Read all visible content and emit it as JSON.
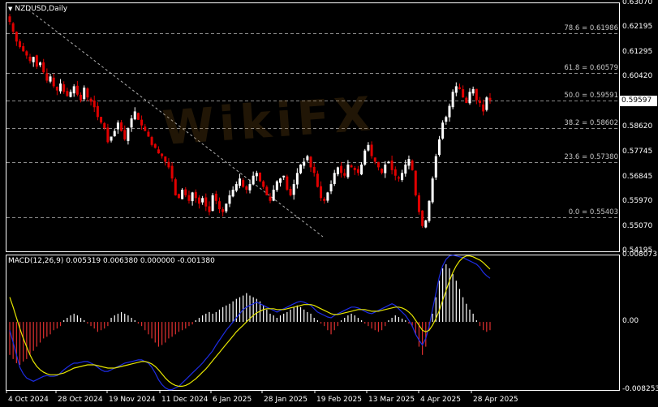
{
  "window": {
    "symbol_title": "NZDUSD,Daily",
    "macd_title": "MACD(12,26,9) 0.005319 0.006380 0.000000 -0.001380",
    "watermark": "WikiFX"
  },
  "colors": {
    "background": "#000000",
    "grid_border": "#ffffff",
    "bull_candle": "#ffffff",
    "bear_candle": "#e00000",
    "fib_line": "#8c8c8c",
    "trendline": "#b0b0b0",
    "macd_line": "#1e2de6",
    "signal_line": "#e6e600",
    "hist_pos": "#ffffff",
    "hist_neg": "#e03030"
  },
  "price_axis": {
    "labels": [
      "0.63070",
      "0.62195",
      "0.61295",
      "0.60420",
      "0.59520",
      "0.58620",
      "0.57745",
      "0.56845",
      "0.55970",
      "0.55070",
      "0.54195"
    ],
    "current_price": "0.59597"
  },
  "macd_axis": {
    "labels": [
      "0.008073",
      "0.00",
      "-0.008253"
    ]
  },
  "date_axis": {
    "labels": [
      "4 Oct 2024",
      "28 Oct 2024",
      "19 Nov 2024",
      "11 Dec 2024",
      "6 Jan 2025",
      "28 Jan 2025",
      "19 Feb 2025",
      "13 Mar 2025",
      "4 Apr 2025",
      "28 Apr 2025"
    ]
  },
  "fibonacci": [
    {
      "label": "78.6 = 0.61986",
      "price": 0.61986
    },
    {
      "label": "61.8 = 0.60579",
      "price": 0.60579
    },
    {
      "label": "50.0 = 0.59591",
      "price": 0.59591
    },
    {
      "label": "38.2 = 0.58602",
      "price": 0.58602
    },
    {
      "label": "23.6 = 0.57380",
      "price": 0.5738
    },
    {
      "label": "0.0 = 0.55403",
      "price": 0.55403
    }
  ],
  "chart_data": {
    "type": "candlestick",
    "title": "NZDUSD,Daily",
    "ylim": [
      0.54195,
      0.6307
    ],
    "x_start": "2024-09-30",
    "close_path": [
      0.624,
      0.6205,
      0.617,
      0.615,
      0.6135,
      0.612,
      0.61,
      0.6115,
      0.608,
      0.6095,
      0.606,
      0.603,
      0.6045,
      0.601,
      0.5995,
      0.602,
      0.599,
      0.5975,
      0.599,
      0.601,
      0.598,
      0.596,
      0.6005,
      0.597,
      0.5955,
      0.5935,
      0.59,
      0.588,
      0.586,
      0.581,
      0.583,
      0.585,
      0.588,
      0.585,
      0.582,
      0.586,
      0.5895,
      0.592,
      0.589,
      0.587,
      0.585,
      0.583,
      0.58,
      0.579,
      0.577,
      0.576,
      0.574,
      0.572,
      0.568,
      0.562,
      0.561,
      0.564,
      0.562,
      0.56,
      0.563,
      0.561,
      0.559,
      0.561,
      0.558,
      0.556,
      0.562,
      0.56,
      0.557,
      0.556,
      0.559,
      0.562,
      0.564,
      0.566,
      0.568,
      0.565,
      0.564,
      0.566,
      0.569,
      0.57,
      0.567,
      0.565,
      0.562,
      0.56,
      0.564,
      0.567,
      0.568,
      0.569,
      0.564,
      0.562,
      0.566,
      0.57,
      0.573,
      0.574,
      0.576,
      0.572,
      0.57,
      0.565,
      0.561,
      0.56,
      0.563,
      0.566,
      0.57,
      0.572,
      0.57,
      0.569,
      0.573,
      0.572,
      0.571,
      0.57,
      0.573,
      0.578,
      0.58,
      0.576,
      0.574,
      0.572,
      0.57,
      0.573,
      0.574,
      0.571,
      0.569,
      0.568,
      0.57,
      0.573,
      0.575,
      0.571,
      0.562,
      0.556,
      0.551,
      0.553,
      0.56,
      0.568,
      0.576,
      0.582,
      0.588,
      0.59,
      0.594,
      0.599,
      0.601,
      0.6,
      0.597,
      0.595,
      0.599,
      0.6,
      0.596,
      0.595,
      0.592,
      0.597,
      0.596
    ]
  },
  "macd_data": {
    "hist": [
      -0.004,
      -0.0045,
      -0.005,
      -0.0052,
      -0.0048,
      -0.0045,
      -0.004,
      -0.0035,
      -0.003,
      -0.0025,
      -0.002,
      -0.0018,
      -0.0015,
      -0.001,
      -0.0008,
      -0.0005,
      0.0002,
      0.0005,
      0.0008,
      0.001,
      0.0008,
      0.0005,
      0.0002,
      -0.0002,
      -0.0005,
      -0.0008,
      -0.0012,
      -0.001,
      -0.0008,
      -0.0005,
      0.0005,
      0.0008,
      0.001,
      0.0012,
      0.001,
      0.0008,
      0.0005,
      0.0002,
      -0.0002,
      -0.0005,
      -0.001,
      -0.0015,
      -0.002,
      -0.0025,
      -0.003,
      -0.0028,
      -0.0025,
      -0.002,
      -0.0018,
      -0.0015,
      -0.0012,
      -0.001,
      -0.0008,
      -0.0005,
      -0.0003,
      0.0002,
      0.0005,
      0.0008,
      0.001,
      0.0012,
      0.001,
      0.0012,
      0.0015,
      0.0018,
      0.002,
      0.0022,
      0.0025,
      0.0028,
      0.003,
      0.0032,
      0.0035,
      0.0032,
      0.003,
      0.0028,
      0.0025,
      0.002,
      0.0015,
      0.001,
      0.0008,
      0.0005,
      0.0008,
      0.001,
      0.0012,
      0.0015,
      0.0018,
      0.002,
      0.0018,
      0.0015,
      0.0012,
      0.001,
      0.0005,
      0.0002,
      -0.0002,
      -0.0005,
      -0.001,
      -0.0015,
      -0.001,
      -0.0005,
      0.0002,
      0.0005,
      0.0008,
      0.001,
      0.0008,
      0.0005,
      0.0002,
      -0.0002,
      -0.0005,
      -0.0008,
      -0.001,
      -0.0012,
      -0.001,
      -0.0005,
      0.0002,
      0.0005,
      0.0008,
      0.0006,
      0.0004,
      0.0002,
      -0.0002,
      -0.0006,
      -0.0015,
      -0.003,
      -0.004,
      -0.003,
      -0.001,
      0.001,
      0.003,
      0.005,
      0.0065,
      0.007,
      0.0065,
      0.0058,
      0.005,
      0.004,
      0.003,
      0.0022,
      0.0015,
      0.001,
      0.0002,
      -0.0005,
      -0.001,
      -0.0012,
      -0.001
    ],
    "macd": [
      -0.001,
      -0.0025,
      -0.004,
      -0.0055,
      -0.0063,
      -0.0068,
      -0.007,
      -0.0072,
      -0.007,
      -0.0068,
      -0.0066,
      -0.0065,
      -0.0066,
      -0.0066,
      -0.0065,
      -0.0062,
      -0.0058,
      -0.0055,
      -0.0052,
      -0.005,
      -0.005,
      -0.0049,
      -0.0048,
      -0.0048,
      -0.005,
      -0.0052,
      -0.0055,
      -0.0058,
      -0.006,
      -0.006,
      -0.0058,
      -0.0056,
      -0.0054,
      -0.0052,
      -0.005,
      -0.0049,
      -0.0048,
      -0.0047,
      -0.0046,
      -0.0046,
      -0.0048,
      -0.005,
      -0.0055,
      -0.0062,
      -0.007,
      -0.0076,
      -0.008,
      -0.0082,
      -0.0082,
      -0.008,
      -0.0078,
      -0.0074,
      -0.007,
      -0.0066,
      -0.0062,
      -0.0058,
      -0.0054,
      -0.005,
      -0.0045,
      -0.004,
      -0.0035,
      -0.0028,
      -0.0022,
      -0.0016,
      -0.001,
      -0.0005,
      0.0,
      0.0005,
      0.001,
      0.0015,
      0.0018,
      0.002,
      0.0022,
      0.0024,
      0.0022,
      0.002,
      0.0018,
      0.0016,
      0.0014,
      0.0012,
      0.0014,
      0.0016,
      0.0018,
      0.002,
      0.0022,
      0.0024,
      0.0025,
      0.0024,
      0.0022,
      0.002,
      0.0016,
      0.0012,
      0.001,
      0.0008,
      0.0006,
      0.0005,
      0.0008,
      0.001,
      0.0012,
      0.0014,
      0.0016,
      0.0018,
      0.0018,
      0.0017,
      0.0015,
      0.0013,
      0.0011,
      0.001,
      0.0012,
      0.0014,
      0.0016,
      0.0018,
      0.002,
      0.0022,
      0.002,
      0.0016,
      0.0012,
      0.0008,
      0.0002,
      -0.0005,
      -0.0015,
      -0.0022,
      -0.0028,
      -0.002,
      -0.0005,
      0.0015,
      0.0035,
      0.0055,
      0.0068,
      0.0076,
      0.008,
      0.0081,
      0.008,
      0.0079,
      0.0078,
      0.0076,
      0.0074,
      0.0072,
      0.007,
      0.0066,
      0.006,
      0.0056,
      0.0053
    ],
    "signal": [
      0.003,
      0.0018,
      0.0005,
      -0.0008,
      -0.002,
      -0.003,
      -0.004,
      -0.0048,
      -0.0054,
      -0.0058,
      -0.0061,
      -0.0063,
      -0.0064,
      -0.0064,
      -0.0064,
      -0.0063,
      -0.0062,
      -0.006,
      -0.0058,
      -0.0056,
      -0.0055,
      -0.0054,
      -0.0053,
      -0.0052,
      -0.0052,
      -0.0052,
      -0.0053,
      -0.0054,
      -0.0055,
      -0.0056,
      -0.0056,
      -0.0056,
      -0.0055,
      -0.0054,
      -0.0053,
      -0.0052,
      -0.0051,
      -0.005,
      -0.0049,
      -0.0048,
      -0.0048,
      -0.0049,
      -0.0051,
      -0.0054,
      -0.0058,
      -0.0063,
      -0.0068,
      -0.0072,
      -0.0075,
      -0.0077,
      -0.0078,
      -0.0078,
      -0.0077,
      -0.0075,
      -0.0072,
      -0.0069,
      -0.0065,
      -0.0061,
      -0.0057,
      -0.0052,
      -0.0047,
      -0.0042,
      -0.0037,
      -0.0032,
      -0.0027,
      -0.0022,
      -0.0017,
      -0.0012,
      -0.0008,
      -0.0004,
      0.0,
      0.0004,
      0.0008,
      0.0011,
      0.0013,
      0.0015,
      0.0016,
      0.0016,
      0.0016,
      0.0015,
      0.0015,
      0.0015,
      0.0016,
      0.0017,
      0.0018,
      0.0019,
      0.002,
      0.0021,
      0.0021,
      0.0021,
      0.002,
      0.0018,
      0.0016,
      0.0014,
      0.0012,
      0.001,
      0.0009,
      0.0009,
      0.001,
      0.0011,
      0.0012,
      0.0013,
      0.0014,
      0.0015,
      0.0015,
      0.0015,
      0.0014,
      0.0013,
      0.0013,
      0.0013,
      0.0014,
      0.0015,
      0.0016,
      0.0017,
      0.0018,
      0.0018,
      0.0017,
      0.0015,
      0.0012,
      0.0008,
      0.0002,
      -0.0004,
      -0.001,
      -0.0012,
      -0.001,
      -0.0004,
      0.0004,
      0.0014,
      0.0026,
      0.0038,
      0.005,
      0.006,
      0.0068,
      0.0074,
      0.0078,
      0.008,
      0.008,
      0.0079,
      0.0077,
      0.0075,
      0.0072,
      0.0068,
      0.0064
    ]
  }
}
